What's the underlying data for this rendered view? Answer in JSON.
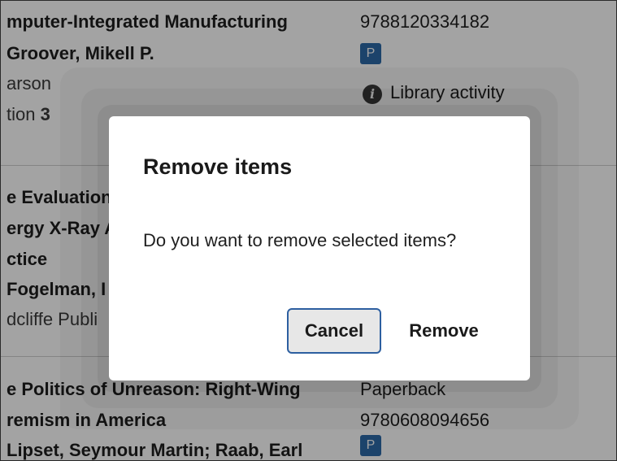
{
  "background": {
    "rows": [
      {
        "lines": [
          "mputer-Integrated Manufacturing",
          "Groover, Mikell P.",
          "arson",
          "tion"
        ],
        "edition_number": "3",
        "isbn": "9788120334182",
        "badge": "P",
        "library_activity": "Library activity"
      },
      {
        "lines": [
          "e Evaluation",
          "ergy X-Ray A",
          "ctice",
          "Fogelman, I",
          "dcliffe Publi"
        ]
      },
      {
        "lines": [
          "e Politics of Unreason: Right-Wing",
          "remism in America",
          "Lipset, Seymour Martin; Raab, Earl"
        ],
        "format": "Paperback",
        "isbn": "9780608094656",
        "badge": "P"
      }
    ]
  },
  "dialog": {
    "title": "Remove items",
    "message": "Do you want to remove selected items?",
    "cancel_label": "Cancel",
    "remove_label": "Remove"
  }
}
